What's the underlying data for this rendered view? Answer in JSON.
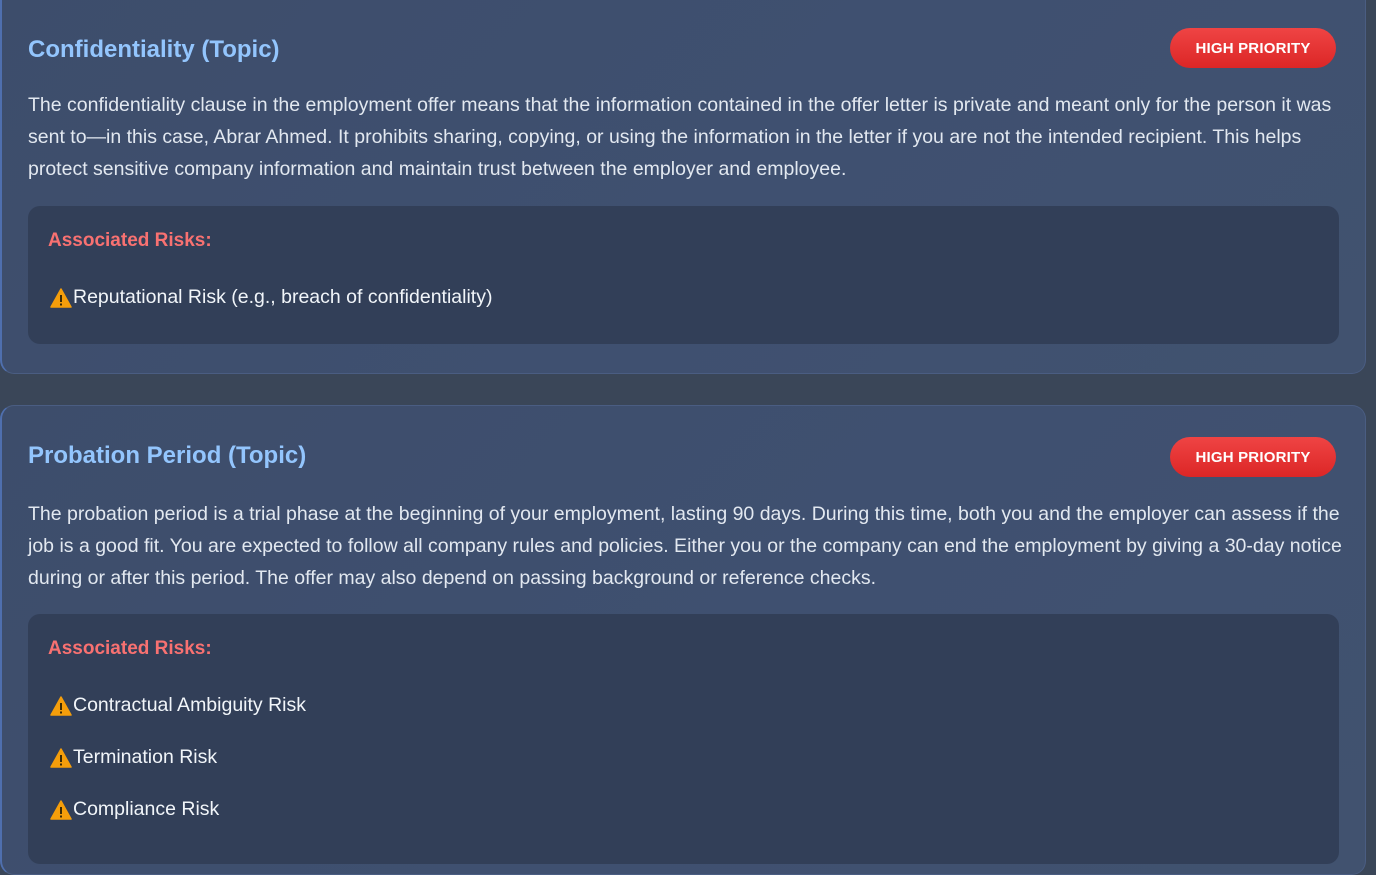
{
  "topics": [
    {
      "title": "Confidentiality (Topic)",
      "priority": "HIGH PRIORITY",
      "description": "The confidentiality clause in the employment offer means that the information contained in the offer letter is private and meant only for the person it was sent to—in this case, Abrar Ahmed. It prohibits sharing, copying, or using the information in the letter if you are not the intended recipient. This helps protect sensitive company information and maintain trust between the employer and employee.",
      "risks_heading": "Associated Risks:",
      "risks": [
        "Reputational Risk (e.g., breach of confidentiality)"
      ]
    },
    {
      "title": "Probation Period (Topic)",
      "priority": "HIGH PRIORITY",
      "description": "The probation period is a trial phase at the beginning of your employment, lasting 90 days. During this time, both you and the employer can assess if the job is a good fit. You are expected to follow all company rules and policies. Either you or the company can end the employment by giving a 30-day notice during or after this period. The offer may also depend on passing background or reference checks.",
      "risks_heading": "Associated Risks:",
      "risks": [
        "Contractual Ambiguity Risk",
        "Termination Risk",
        "Compliance Risk"
      ]
    }
  ],
  "icons": {
    "risk_item_icon": "warning-icon"
  },
  "colors": {
    "title": "#93c5fd",
    "priority_badge": "#ef4444",
    "risks_heading": "#f87171",
    "warning_icon": "#f59e0b"
  }
}
